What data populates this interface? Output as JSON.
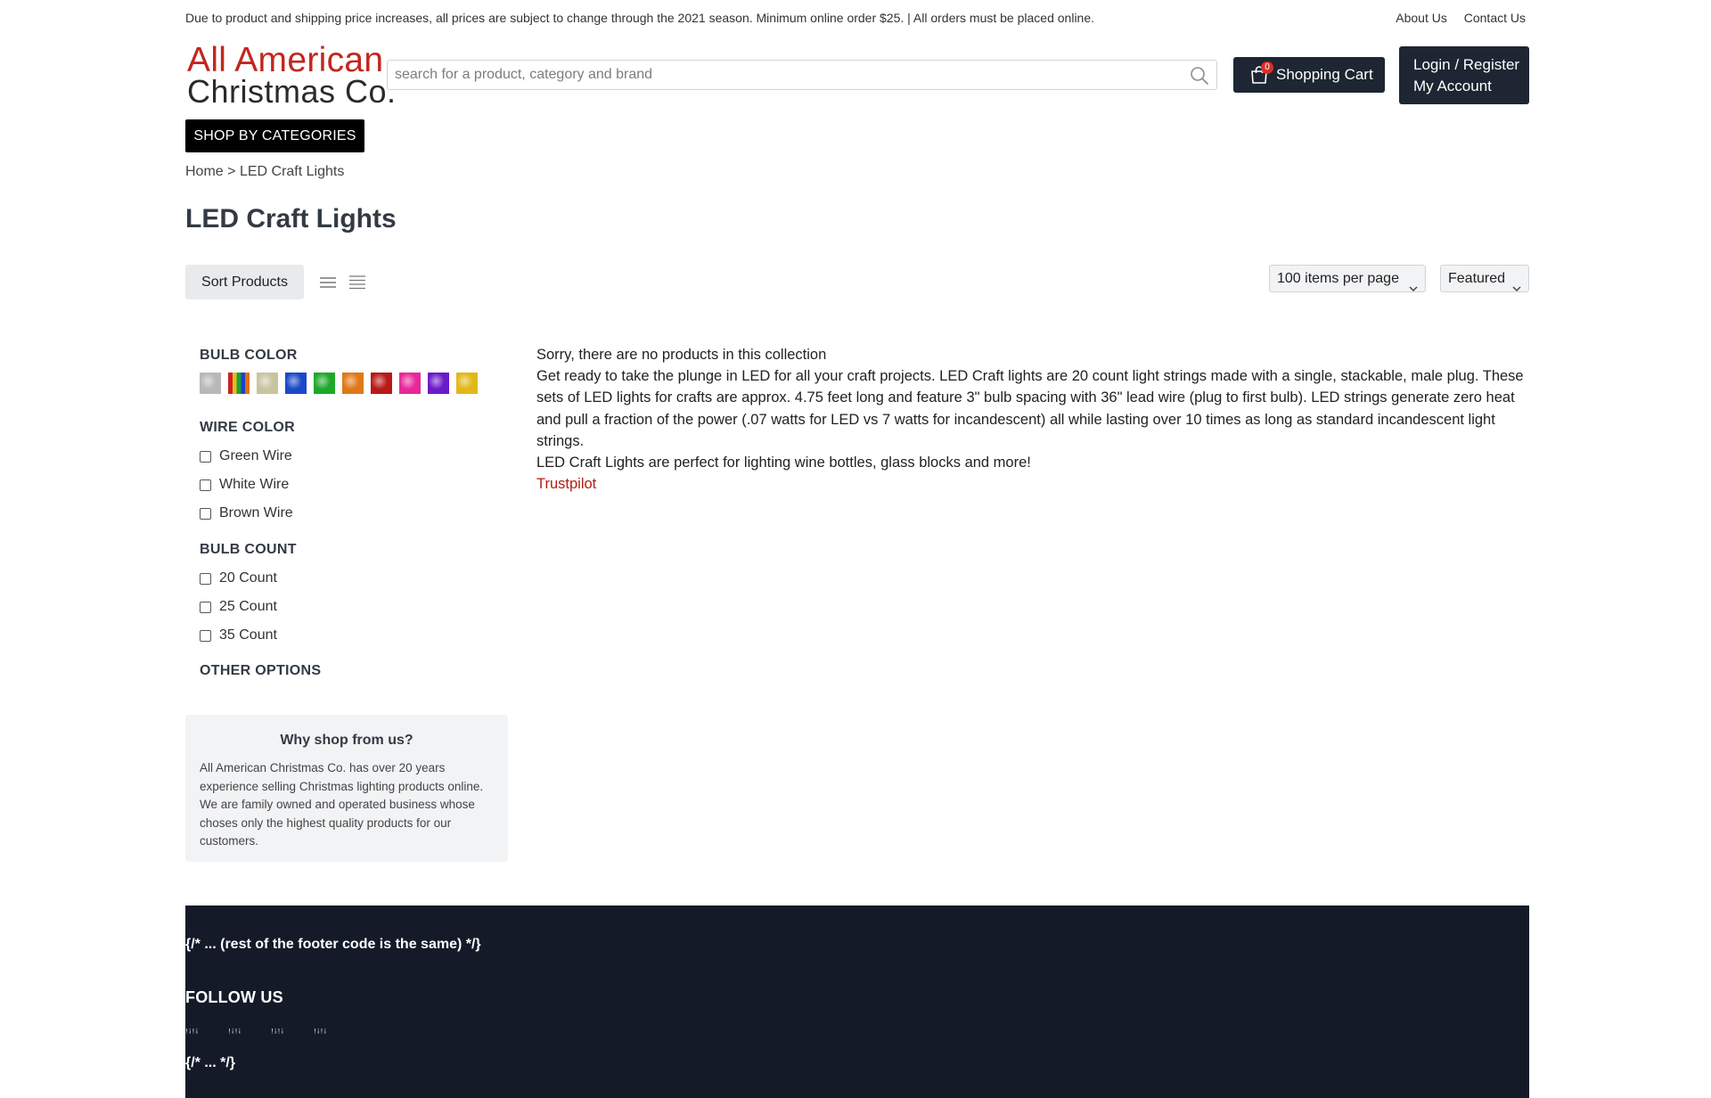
{
  "topbar": {
    "notice": "Due to product and shipping price increases, all prices are subject to change through the 2021 season. Minimum online order $25. | All orders must be placed online.",
    "about_us": "About Us",
    "contact_us": "Contact Us"
  },
  "logo": {
    "line1": "All American",
    "line2": "Christmas Co."
  },
  "search": {
    "placeholder": "search for a product, category and brand",
    "icon": "search-icon"
  },
  "cart": {
    "label": "Shopping Cart",
    "count": "0",
    "icon": "shopping-bag-icon"
  },
  "account": {
    "login_label": "Login / Register",
    "account_label": "My Account"
  },
  "nav": {
    "shop_by_categories": "SHOP BY CATEGORIES"
  },
  "breadcrumb": {
    "home": "Home",
    "separator": ">",
    "current": "LED Craft Lights"
  },
  "page": {
    "title": "LED Craft Lights"
  },
  "toolbar": {
    "sort_label": "Sort Products",
    "per_page": "100 items per page",
    "sort_order": "Featured"
  },
  "filters": {
    "bulb_color": {
      "heading": "BULB COLOR",
      "swatches": [
        {
          "name": "silver",
          "color": "#b8b8b8"
        },
        {
          "name": "multicolor",
          "color": "#5a3a8a"
        },
        {
          "name": "warm-white",
          "color": "#c8c4a0"
        },
        {
          "name": "blue",
          "color": "#1a48c8"
        },
        {
          "name": "green",
          "color": "#1ea82a"
        },
        {
          "name": "orange",
          "color": "#e07818"
        },
        {
          "name": "red",
          "color": "#b81818"
        },
        {
          "name": "pink",
          "color": "#e8289a"
        },
        {
          "name": "purple",
          "color": "#6a1ac8"
        },
        {
          "name": "gold",
          "color": "#e0b818"
        }
      ]
    },
    "wire_color": {
      "heading": "WIRE COLOR",
      "options": [
        "Green Wire",
        "White Wire",
        "Brown Wire"
      ]
    },
    "bulb_count": {
      "heading": "BULB COUNT",
      "options": [
        "20 Count",
        "25 Count",
        "35 Count"
      ]
    },
    "other_options": {
      "heading": "OTHER OPTIONS"
    }
  },
  "why_shop": {
    "heading": "Why shop from us?",
    "body": "All American Christmas Co. has over 20 years experience selling Christmas lighting products online. We are family owned and operated business whose choses only the highest quality products for our customers."
  },
  "content": {
    "empty_message": "Sorry, there are no products in this collection",
    "description": "Get ready to take the plunge in LED for all your craft projects. LED Craft lights are 20 count light strings made with a single, stackable, male plug. These sets of LED lights for crafts are approx. 4.75 feet long and feature 3\" bulb spacing with 36\" lead wire (plug to first bulb). LED strings generate zero heat and pull a fraction of the power (.07 watts for LED vs 7 watts for incandescent) all while lasting over 10 times as long as standard incandescent light strings.",
    "tagline": "LED Craft Lights are perfect for lighting wine bottles, glass blocks and more!",
    "trustpilot": "Trustpilot"
  },
  "footer": {
    "code_comment_1": "{/* ... (rest of the footer code is the same) */}",
    "follow_us": "FOLLOW US",
    "social_glyphs": [
      "ꜝꜞꜝꜞ",
      "ꜝꜞꜝꜞ",
      "ꜝꜞꜝꜞ",
      "ꜝꜞꜝꜞ"
    ],
    "code_comment_2": "{/* ... */}"
  }
}
